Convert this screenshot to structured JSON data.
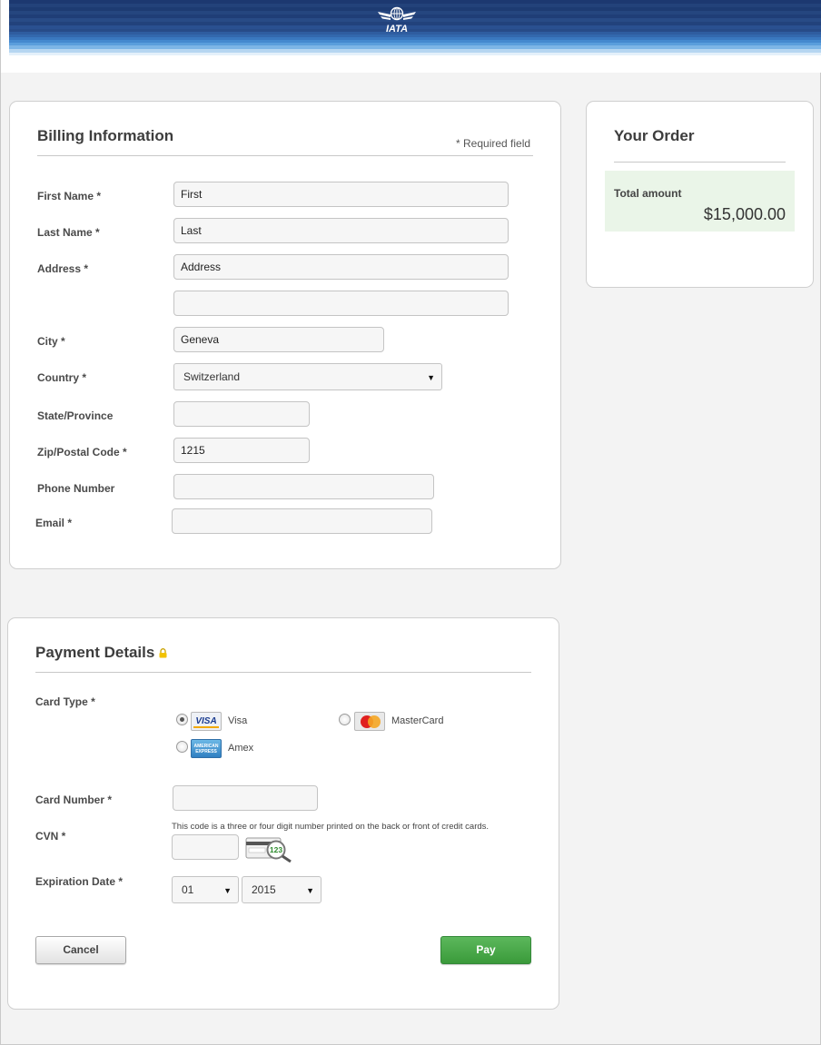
{
  "header": {
    "logo_text": "IATA",
    "logo_icon": "iata-globe-wings-icon"
  },
  "billing": {
    "title": "Billing Information",
    "required_note": "* Required field",
    "first_name": {
      "label": "First Name *",
      "value": "First"
    },
    "last_name": {
      "label": "Last Name *",
      "value": "Last"
    },
    "address": {
      "label": "Address *",
      "line1": "Address",
      "line2": ""
    },
    "city": {
      "label": "City *",
      "value": "Geneva"
    },
    "country": {
      "label": "Country *",
      "value": "Switzerland"
    },
    "state": {
      "label": "State/Province",
      "value": ""
    },
    "zip": {
      "label": "Zip/Postal Code *",
      "value": "1215"
    },
    "phone": {
      "label": "Phone Number",
      "value": ""
    },
    "email": {
      "label": "Email *",
      "value": ""
    }
  },
  "order": {
    "title": "Your Order",
    "total_label": "Total amount",
    "total_value": "$15,000.00",
    "highlight_color": "#eaf5e8"
  },
  "payment": {
    "title": "Payment Details",
    "lock_icon": "lock-icon",
    "card_type_label": "Card Type *",
    "card_types": [
      {
        "name": "Visa",
        "icon": "visa-card-icon",
        "selected": true
      },
      {
        "name": "MasterCard",
        "icon": "mastercard-icon",
        "selected": false
      },
      {
        "name": "Amex",
        "icon": "amex-card-icon",
        "selected": false
      }
    ],
    "card_number": {
      "label": "Card Number *",
      "value": ""
    },
    "cvn": {
      "label": "CVN *",
      "hint": "This code is a three or four digit number printed on the back or front of credit cards.",
      "value": "",
      "icon": "cvn-card-magnifier-icon"
    },
    "expiration": {
      "label": "Expiration Date *",
      "month": "01",
      "year": "2015"
    },
    "cancel_label": "Cancel",
    "pay_label": "Pay",
    "pay_color": "#4cae4c"
  }
}
